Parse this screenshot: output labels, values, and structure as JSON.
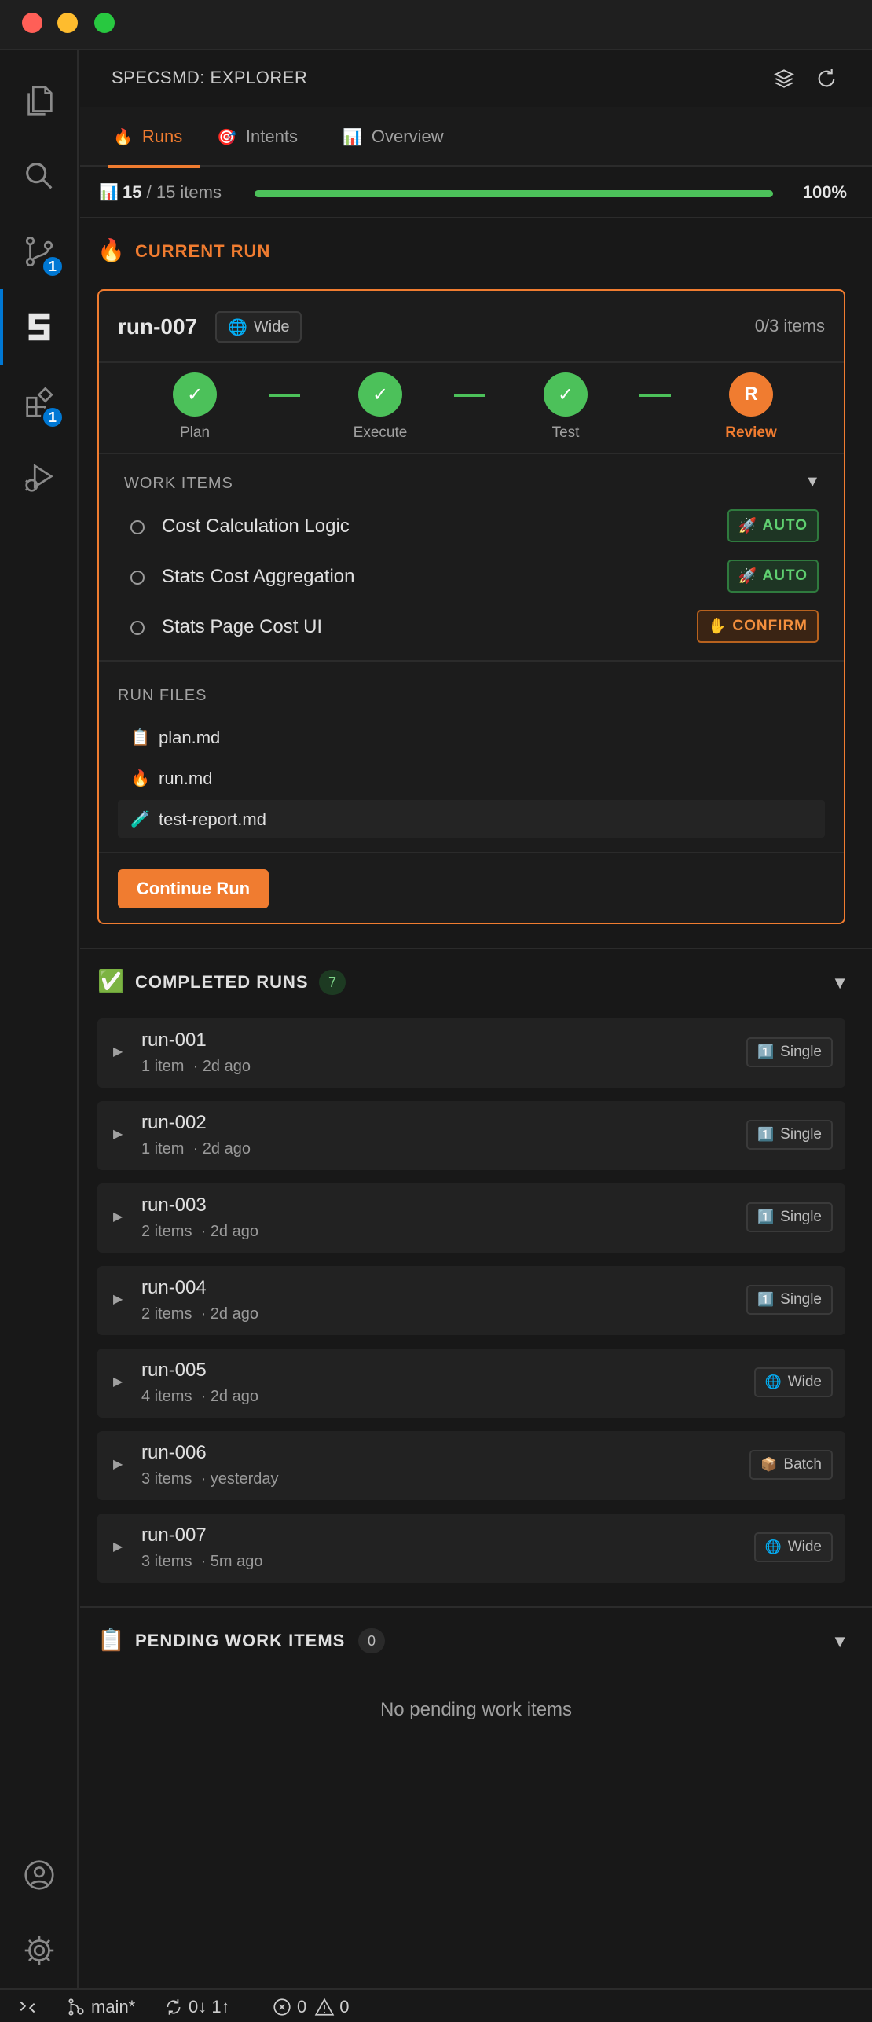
{
  "sidebar_header": {
    "title": "SPECSMD: EXPLORER"
  },
  "activity_badges": {
    "source_control": "1",
    "extensions": "1"
  },
  "tabs": [
    {
      "icon": "🔥",
      "label": "Runs"
    },
    {
      "icon": "🎯",
      "label": "Intents"
    },
    {
      "icon": "📊",
      "label": "Overview"
    }
  ],
  "progress": {
    "icon": "📊",
    "done": "15",
    "total_text": "/ 15 items",
    "percent": "100%",
    "fraction": 1.0
  },
  "current_run": {
    "section_icon": "🔥",
    "section_title": "CURRENT RUN",
    "run_id": "run-007",
    "scope_icon": "🌐",
    "scope": "Wide",
    "items_text": "0/3 items",
    "steps": [
      {
        "mark": "✓",
        "label": "Plan"
      },
      {
        "mark": "✓",
        "label": "Execute"
      },
      {
        "mark": "✓",
        "label": "Test"
      },
      {
        "mark": "R",
        "label": "Review"
      }
    ],
    "work_items_title": "WORK ITEMS",
    "work_items": [
      {
        "label": "Cost Calculation Logic",
        "mode_icon": "🚀",
        "mode": "AUTO"
      },
      {
        "label": "Stats Cost Aggregation",
        "mode_icon": "🚀",
        "mode": "AUTO"
      },
      {
        "label": "Stats Page Cost UI",
        "mode_icon": "✋",
        "mode": "CONFIRM"
      }
    ],
    "run_files_title": "RUN FILES",
    "run_files": [
      {
        "icon": "📋",
        "name": "plan.md"
      },
      {
        "icon": "🔥",
        "name": "run.md"
      },
      {
        "icon": "🧪",
        "name": "test-report.md"
      }
    ],
    "continue_label": "Continue Run"
  },
  "completed_runs": {
    "icon": "✅",
    "title": "COMPLETED RUNS",
    "count": "7",
    "arrow": "▶",
    "runs": [
      {
        "id": "run-001",
        "items": "1 item",
        "ago": "· 2d ago",
        "scope_icon": "1️⃣",
        "scope": "Single"
      },
      {
        "id": "run-002",
        "items": "1 item",
        "ago": "· 2d ago",
        "scope_icon": "1️⃣",
        "scope": "Single"
      },
      {
        "id": "run-003",
        "items": "2 items",
        "ago": "· 2d ago",
        "scope_icon": "1️⃣",
        "scope": "Single"
      },
      {
        "id": "run-004",
        "items": "2 items",
        "ago": "· 2d ago",
        "scope_icon": "1️⃣",
        "scope": "Single"
      },
      {
        "id": "run-005",
        "items": "4 items",
        "ago": "· 2d ago",
        "scope_icon": "🌐",
        "scope": "Wide"
      },
      {
        "id": "run-006",
        "items": "3 items",
        "ago": "· yesterday",
        "scope_icon": "📦",
        "scope": "Batch"
      },
      {
        "id": "run-007",
        "items": "3 items",
        "ago": "· 5m ago",
        "scope_icon": "🌐",
        "scope": "Wide"
      }
    ]
  },
  "pending": {
    "icon": "📋",
    "title": "PENDING WORK ITEMS",
    "count": "0",
    "empty_text": "No pending work items"
  },
  "chevron": "▼",
  "statusbar": {
    "branch": "main*",
    "sync": "0↓ 1↑",
    "errors": "0",
    "warnings": "0"
  },
  "colors": {
    "accent": "#f07c30",
    "success": "#4cc15a",
    "badge": "#0078d4"
  }
}
